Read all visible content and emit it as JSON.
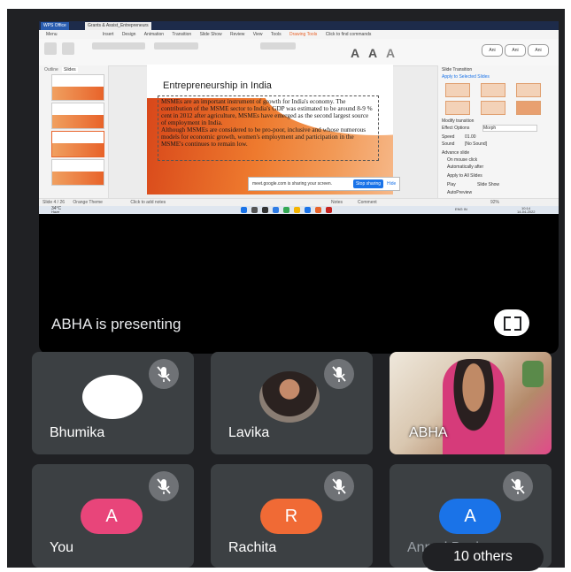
{
  "screen_share": {
    "tabs": [
      "WPS Office",
      "Grants & Assist_Entrepreneurs"
    ],
    "menu": [
      "Menu",
      "Insert",
      "Design",
      "Animation",
      "Transition",
      "Slide Show",
      "Review",
      "View",
      "Tools",
      "Drawing Tools",
      "Click to find commands"
    ],
    "ribbon_pills": [
      "Ani",
      "Ani",
      "Ani"
    ],
    "thumbnail_panel_tabs": [
      "Outline",
      "Slides"
    ],
    "slide": {
      "title": "Entrepreneurship in India",
      "paragraph_1": "MSMEs are an important instrument of growth for India's economy. The contribution of the MSME sector to India's GDP was estimated to be around 8-9 % cent in 2012 after agriculture, MSMEs have emerged as the second largest source of employment in India.",
      "paragraph_2": "Although MSMEs are considered to be pro-poor, inclusive and whose numerous models for economic growth, women's employment and participation in the MSME's continues to remain low."
    },
    "share_bar": {
      "message": "meet.google.com is sharing your screen.",
      "stop_label": "Stop sharing",
      "hide_label": "Hide"
    },
    "right_pane": {
      "header": "Slide Transition",
      "apply_label": "Apply to Selected Slides",
      "tiles": [
        "None",
        "Morph",
        "Fade",
        "Reveal",
        "Wipe",
        "Shape"
      ],
      "modify_label": "Modify transition",
      "effect_label": "Effect Options",
      "effect_value": "Morph",
      "speed_label": "Speed",
      "speed_value": "01.00",
      "sound_label": "Sound",
      "sound_value": "[No Sound]",
      "advance_label": "Advance slide",
      "on_click": "On mouse click",
      "auto": "Automatically after",
      "apply_all": "Apply to All Slides",
      "play": "Play",
      "slideshow": "Slide Show",
      "autopreview": "AutoPreview"
    },
    "status": {
      "slide_count": "Slide 4 / 26",
      "theme": "Orange Theme",
      "notes": "Click to add notes",
      "zoom": "92%",
      "notes_btn": "Notes",
      "comment_btn": "Comment"
    },
    "taskbar": {
      "weather": "34°C",
      "weather_desc": "Haze",
      "lang": "ENG IN",
      "time": "10:14",
      "date": "14-04-2022"
    }
  },
  "presenter_label": "ABHA is presenting",
  "participants": [
    {
      "name": "Bhumika",
      "initial": "",
      "avatar_color": "#ffffff"
    },
    {
      "name": "Lavika",
      "initial": "",
      "avatar_color": "#8a6a5a"
    },
    {
      "name": "ABHA",
      "initial": "",
      "avatar_color": "#e9c9a3"
    },
    {
      "name": "You",
      "initial": "A",
      "avatar_color": "#e8457a"
    },
    {
      "name": "Rachita",
      "initial": "R",
      "avatar_color": "#f06a35"
    },
    {
      "name": "Anmol Basis",
      "initial": "A",
      "avatar_color": "#1a73e8"
    }
  ],
  "others_label": "10 others",
  "colors": {
    "meet_bg": "#202124",
    "tile_bg": "#3c4043",
    "slide_orange": "#e8632a"
  }
}
